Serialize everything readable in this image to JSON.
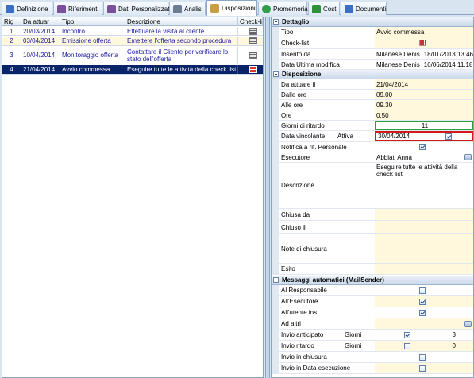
{
  "tabs": [
    {
      "label": "Definizione",
      "icon": "definition-icon",
      "color": "#3b6fc4"
    },
    {
      "label": "Riferimenti",
      "icon": "references-icon",
      "color": "#7a4f9c"
    },
    {
      "label": "Dati Personalizzati",
      "icon": "custom-data-icon",
      "color": "#7a4f9c"
    },
    {
      "label": "Analisi",
      "icon": "analysis-icon",
      "color": "#6b7c93"
    },
    {
      "label": "Disposizioni",
      "icon": "dispositions-icon",
      "color": "#c8a040"
    },
    {
      "label": "Promemoria",
      "icon": "reminder-icon",
      "color": "#2f9d4a"
    },
    {
      "label": "Costi",
      "icon": "costs-icon",
      "color": "#2f8f3a"
    },
    {
      "label": "Documenti",
      "icon": "documents-icon",
      "color": "#3b6fc4"
    }
  ],
  "active_tab": "Disposizioni",
  "grid": {
    "headers": [
      "Riç",
      "Da attuar",
      "Tipo",
      "Descrizione",
      "Check-list"
    ],
    "rows": [
      {
        "n": "1",
        "date": "20/03/2014",
        "tipo": "Incontro",
        "desc": "Effettuare la visita al cliente"
      },
      {
        "n": "2",
        "date": "03/04/2014",
        "tipo": "Emissione offerta",
        "desc": "Emettere l'offerta secondo procedura"
      },
      {
        "n": "3",
        "date": "10/04/2014",
        "tipo": "Monitoraggio offerta",
        "desc": "Contattare il Cliente per verificare lo stato dell'offerta"
      },
      {
        "n": "4",
        "date": "21/04/2014",
        "tipo": "Avvio commessa",
        "desc": "Eseguire tutte le attività della check list"
      }
    ]
  },
  "props": {
    "dettaglio": {
      "title": "Dettaglio",
      "tipo_label": "Tipo",
      "tipo_value": "Avvio commessa",
      "checklist_label": "Check-list",
      "inserito_label": "Inserito da",
      "inserito_user": "Milanese Denis",
      "inserito_date": "18/01/2013 13.46",
      "modifica_label": "Data Ultima modifica",
      "modifica_user": "Milanese Denis",
      "modifica_date": "16/06/2014 11.18"
    },
    "disposizione": {
      "title": "Disposizione",
      "da_attuare_label": "Da attuare il",
      "da_attuare_value": "21/04/2014",
      "dalle_label": "Dalle ore",
      "dalle_value": "09.00",
      "alle_label": "Alle ore",
      "alle_value": "09.30",
      "ore_label": "Ore",
      "ore_value": "0,50",
      "ritardo_label": "Giorni di ritardo",
      "ritardo_value": "11",
      "vincolante_label": "Data vincolante",
      "vincolante_sub": "Attiva",
      "vincolante_value": "30/04/2014",
      "notifica_label": "Notifica a rif. Personale",
      "esecutore_label": "Esecutore",
      "esecutore_value": "Abbiati Anna",
      "descrizione_label": "Descrizione",
      "descrizione_value": "Eseguire tutte le attività della check list",
      "chiusa_da_label": "Chiusa da",
      "chiuso_il_label": "Chiuso il",
      "note_label": "Note di chiusura",
      "esito_label": "Esito"
    },
    "messaggi": {
      "title": "Messaggi automatici (MailSender)",
      "responsabile_label": "Al Responsabile",
      "esecutore_label": "All'Esecutore",
      "utente_label": "All'utente ins.",
      "altri_label": "Ad altri",
      "anticipato_label": "Invio anticipato",
      "anticipato_unit": "Giorni",
      "anticipato_value": "3",
      "ritardo_label": "Invio ritardo",
      "ritardo_unit": "Giorni",
      "ritardo_value": "0",
      "chiusura_label": "Invio in chiusura",
      "esecuzione_label": "Invio in Data esecuzione"
    }
  },
  "colors": {
    "accent": "#0a246a",
    "value_bg": "#fff8dc",
    "ritardo_border": "#2e9b45",
    "vincolante_border": "#d11b1b"
  }
}
